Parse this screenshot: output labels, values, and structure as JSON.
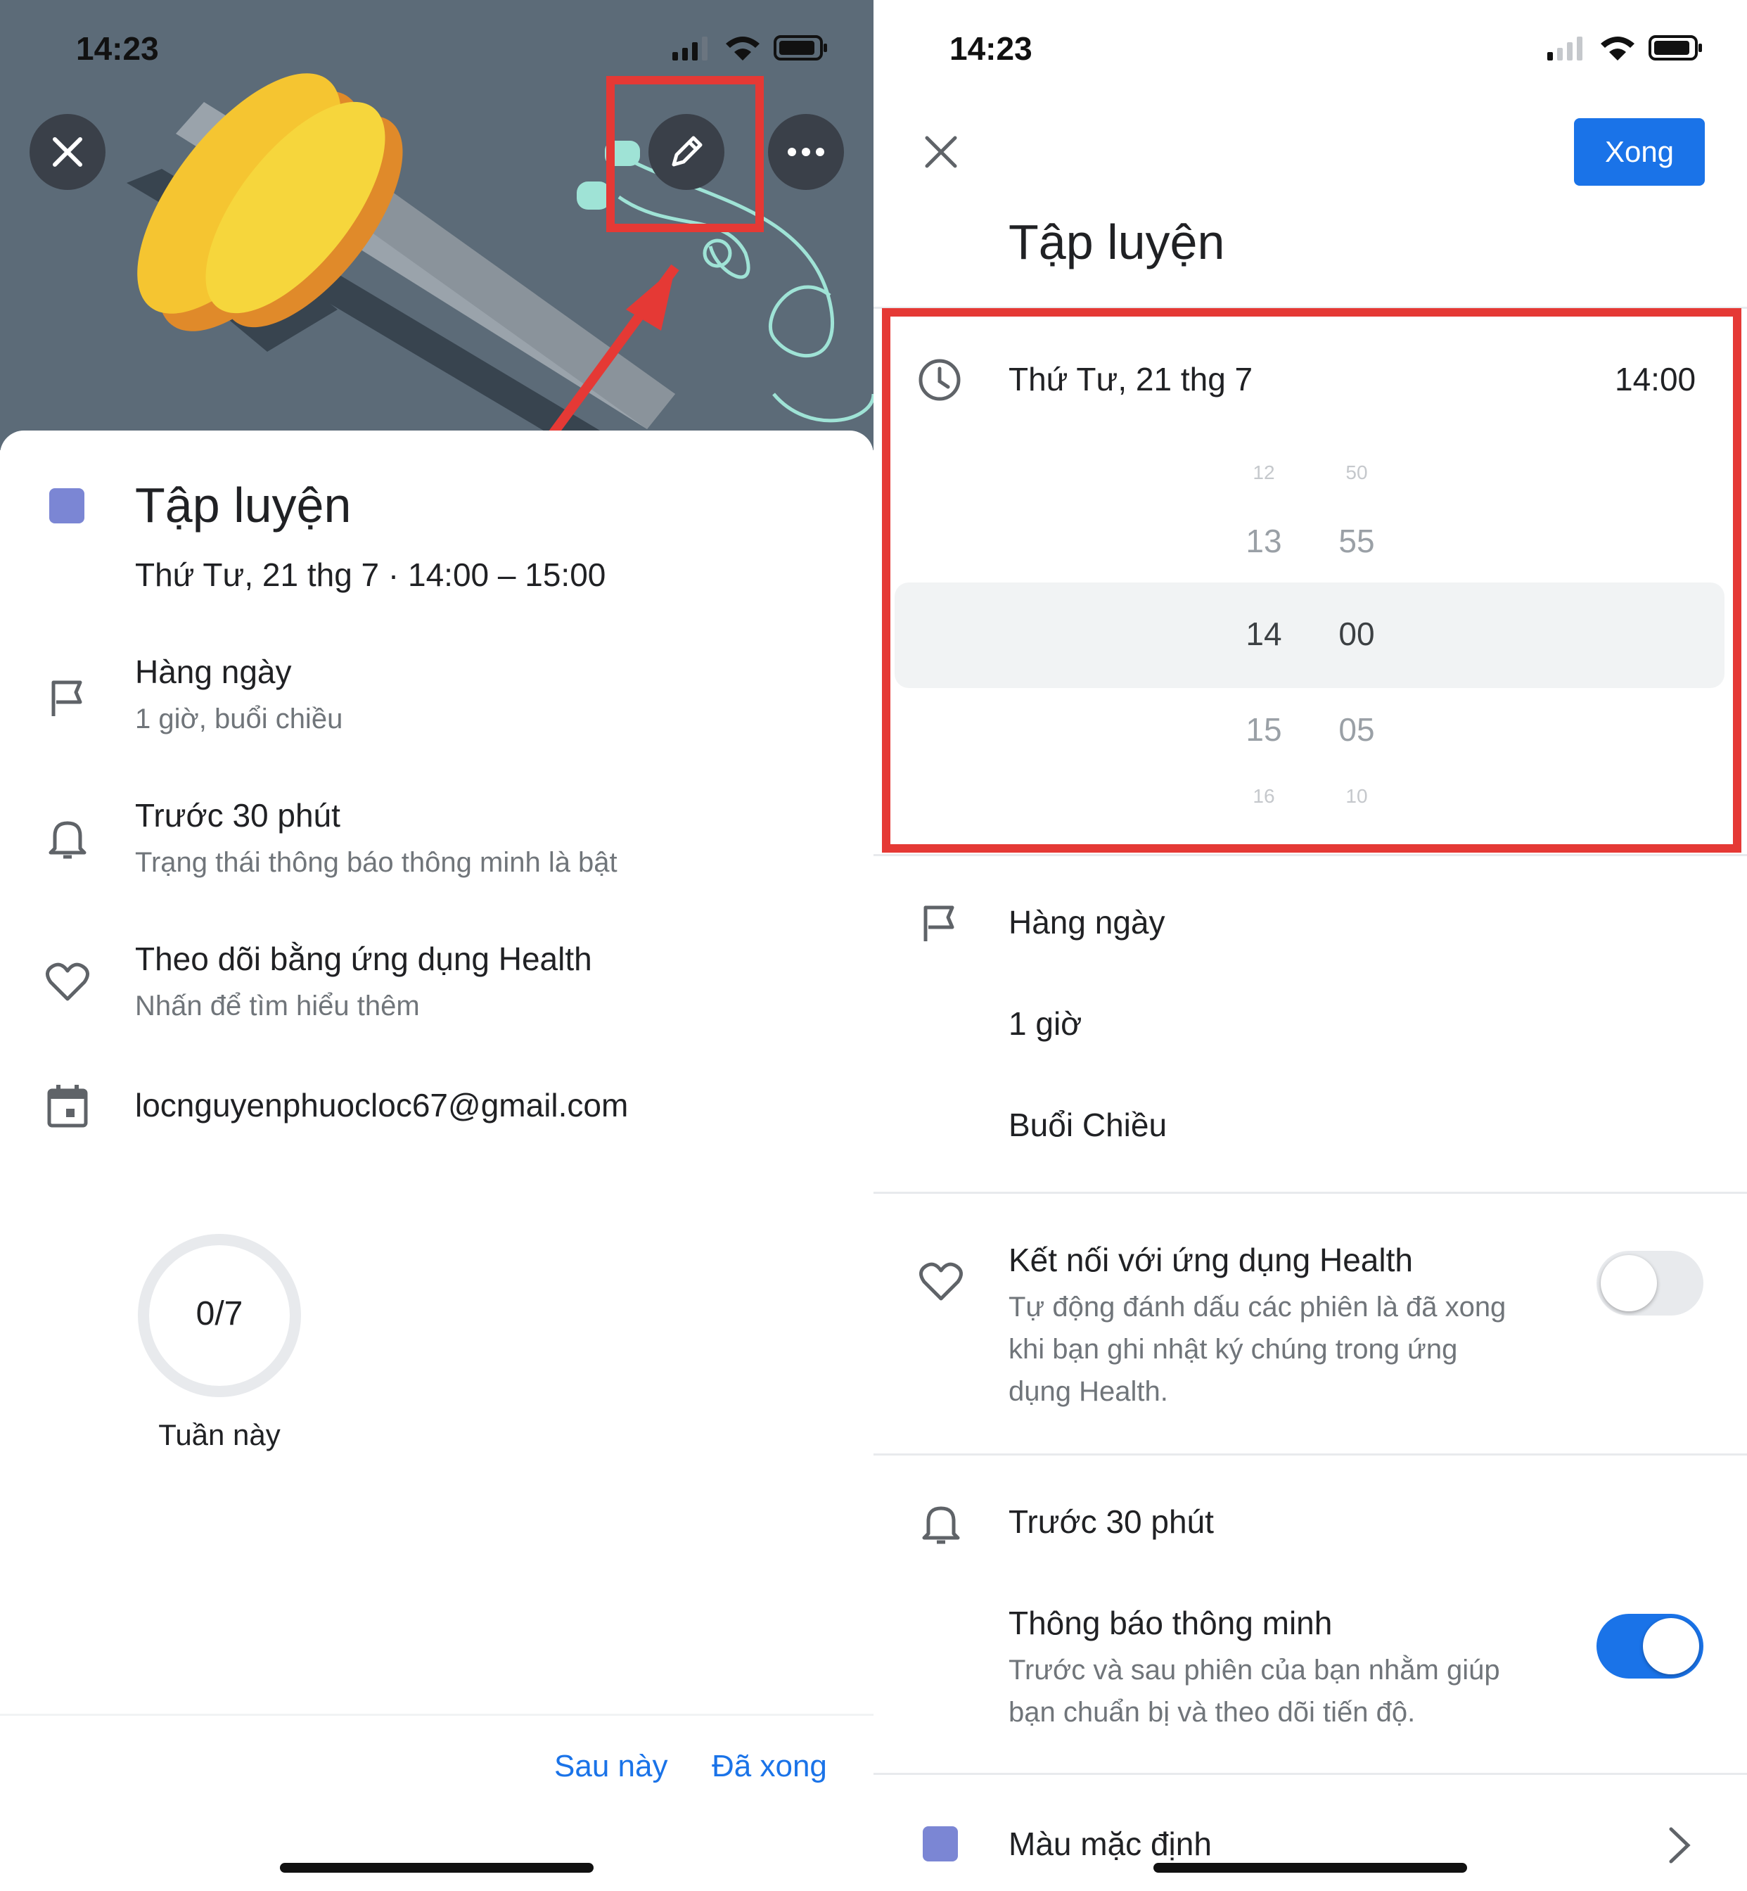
{
  "left": {
    "status_time": "14:23",
    "title": "Tập luyện",
    "subtitle": "Thứ Tư, 21 thg 7 · 14:00 – 15:00",
    "items": [
      {
        "main": "Hàng ngày",
        "sub": "1 giờ, buổi chiều",
        "icon": "flag-icon"
      },
      {
        "main": "Trước 30 phút",
        "sub": "Trạng thái thông báo thông minh là bật",
        "icon": "bell-icon"
      },
      {
        "main": "Theo dõi bằng ứng dụng Health",
        "sub": "Nhấn để tìm hiểu thêm",
        "icon": "heart-icon"
      },
      {
        "main": "locnguyenphuocloc67@gmail.com",
        "sub": "",
        "icon": "calendar-icon"
      }
    ],
    "progress": {
      "value": "0/7",
      "label": "Tuần này",
      "completed": 0,
      "total": 7
    },
    "footer": {
      "later": "Sau này",
      "done": "Đã xong"
    },
    "colors": {
      "goal_color": "#7b86d4",
      "accent": "#1a73e8"
    }
  },
  "right": {
    "status_time": "14:23",
    "done_button": "Xong",
    "title": "Tập luyện",
    "date_label": "Thứ Tư, 21 thg 7",
    "time_value": "14:00",
    "picker": {
      "hours": [
        "12",
        "13",
        "14",
        "15",
        "16"
      ],
      "minutes": [
        "50",
        "55",
        "00",
        "05",
        "10"
      ]
    },
    "frequency": "Hàng ngày",
    "duration": "1 giờ",
    "best_time": "Buổi Chiều",
    "health": {
      "title": "Kết nối với ứng dụng Health",
      "desc_lines": [
        "Tự động đánh dấu các phiên là đã xong",
        "khi bạn ghi nhật ký chúng trong ứng",
        "dụng Health."
      ],
      "enabled": false
    },
    "reminder": "Trước 30 phút",
    "smart": {
      "title": "Thông báo thông minh",
      "desc_lines": [
        "Trước và sau phiên của bạn nhằm giúp",
        "bạn chuẩn bị và theo dõi tiến độ."
      ],
      "enabled": true
    },
    "color_label": "Màu mặc định"
  }
}
